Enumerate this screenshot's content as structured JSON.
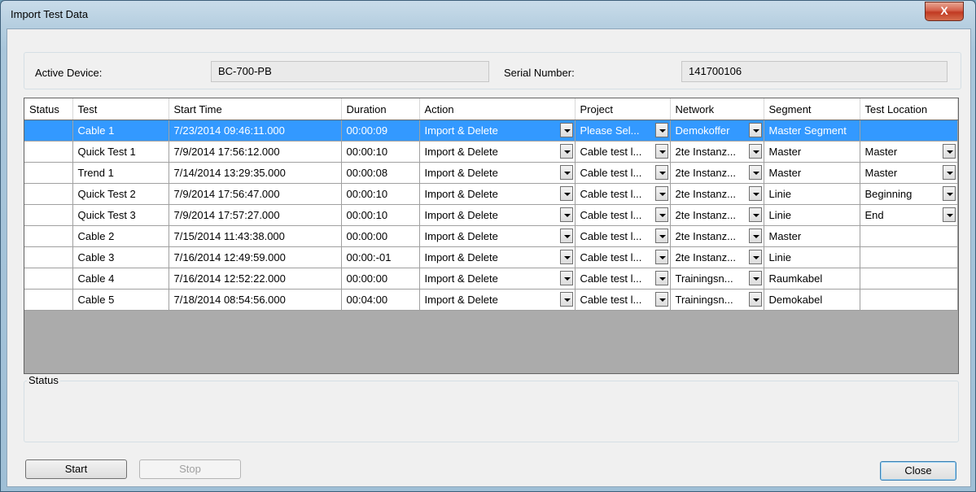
{
  "window": {
    "title": "Import Test Data",
    "close_glyph": "X"
  },
  "device": {
    "active_device_label": "Active Device:",
    "active_device_value": "BC-700-PB",
    "serial_label": "Serial Number:",
    "serial_value": "141700106"
  },
  "grid": {
    "columns": [
      "Status",
      "Test",
      "Start Time",
      "Duration",
      "Action",
      "Project",
      "Network",
      "Segment",
      "Test Location"
    ],
    "rows": [
      {
        "status": "",
        "test": "Cable 1",
        "start": "7/23/2014 09:46:11.000",
        "duration": "00:00:09",
        "action": "Import & Delete",
        "project": "Please Sel...",
        "network": "Demokoffer",
        "segment": "Master Segment",
        "location": "",
        "selected": true,
        "location_combo": false
      },
      {
        "status": "",
        "test": "Quick Test 1",
        "start": "7/9/2014 17:56:12.000",
        "duration": "00:00:10",
        "action": "Import & Delete",
        "project": "Cable test l...",
        "network": "2te Instanz...",
        "segment": "Master",
        "location": "Master",
        "selected": false,
        "location_combo": true
      },
      {
        "status": "",
        "test": "Trend 1",
        "start": "7/14/2014 13:29:35.000",
        "duration": "00:00:08",
        "action": "Import & Delete",
        "project": "Cable test l...",
        "network": "2te Instanz...",
        "segment": "Master",
        "location": "Master",
        "selected": false,
        "location_combo": true
      },
      {
        "status": "",
        "test": "Quick Test 2",
        "start": "7/9/2014 17:56:47.000",
        "duration": "00:00:10",
        "action": "Import & Delete",
        "project": "Cable test l...",
        "network": "2te Instanz...",
        "segment": "Linie",
        "location": "Beginning",
        "selected": false,
        "location_combo": true
      },
      {
        "status": "",
        "test": "Quick Test 3",
        "start": "7/9/2014 17:57:27.000",
        "duration": "00:00:10",
        "action": "Import & Delete",
        "project": "Cable test l...",
        "network": "2te Instanz...",
        "segment": "Linie",
        "location": "End",
        "selected": false,
        "location_combo": true
      },
      {
        "status": "",
        "test": "Cable 2",
        "start": "7/15/2014 11:43:38.000",
        "duration": "00:00:00",
        "action": "Import & Delete",
        "project": "Cable test l...",
        "network": "2te Instanz...",
        "segment": "Master",
        "location": "",
        "selected": false,
        "location_combo": false
      },
      {
        "status": "",
        "test": "Cable 3",
        "start": "7/16/2014 12:49:59.000",
        "duration": "00:00:-01",
        "action": "Import & Delete",
        "project": "Cable test l...",
        "network": "2te Instanz...",
        "segment": "Linie",
        "location": "",
        "selected": false,
        "location_combo": false
      },
      {
        "status": "",
        "test": "Cable 4",
        "start": "7/16/2014 12:52:22.000",
        "duration": "00:00:00",
        "action": "Import & Delete",
        "project": "Cable test l...",
        "network": "Trainingsn...",
        "segment": "Raumkabel",
        "location": "",
        "selected": false,
        "location_combo": false
      },
      {
        "status": "",
        "test": "Cable 5",
        "start": "7/18/2014 08:54:56.000",
        "duration": "00:04:00",
        "action": "Import & Delete",
        "project": "Cable test l...",
        "network": "Trainingsn...",
        "segment": "Demokabel",
        "location": "",
        "selected": false,
        "location_combo": false
      }
    ]
  },
  "status": {
    "group_label": "Status"
  },
  "buttons": {
    "start": "Start",
    "stop": "Stop",
    "close": "Close"
  }
}
